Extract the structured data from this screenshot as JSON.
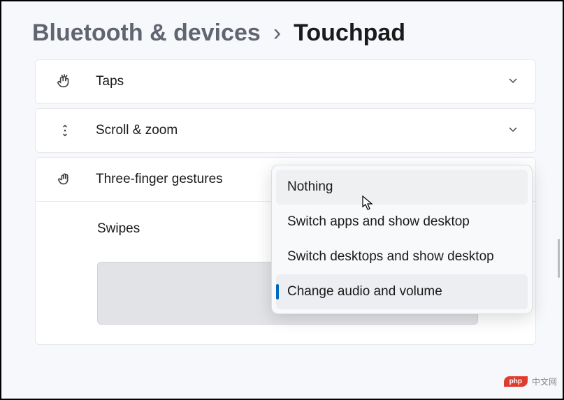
{
  "breadcrumb": {
    "parent": "Bluetooth & devices",
    "separator": "›",
    "current": "Touchpad"
  },
  "cards": {
    "taps": {
      "label": "Taps"
    },
    "scroll": {
      "label": "Scroll & zoom"
    },
    "three_finger": {
      "label": "Three-finger gestures"
    },
    "swipes": {
      "label": "Swipes"
    }
  },
  "dropdown": {
    "items": [
      "Nothing",
      "Switch apps and show desktop",
      "Switch desktops and show desktop",
      "Change audio and volume"
    ]
  },
  "watermark": {
    "logo": "php",
    "text": "中文网"
  }
}
